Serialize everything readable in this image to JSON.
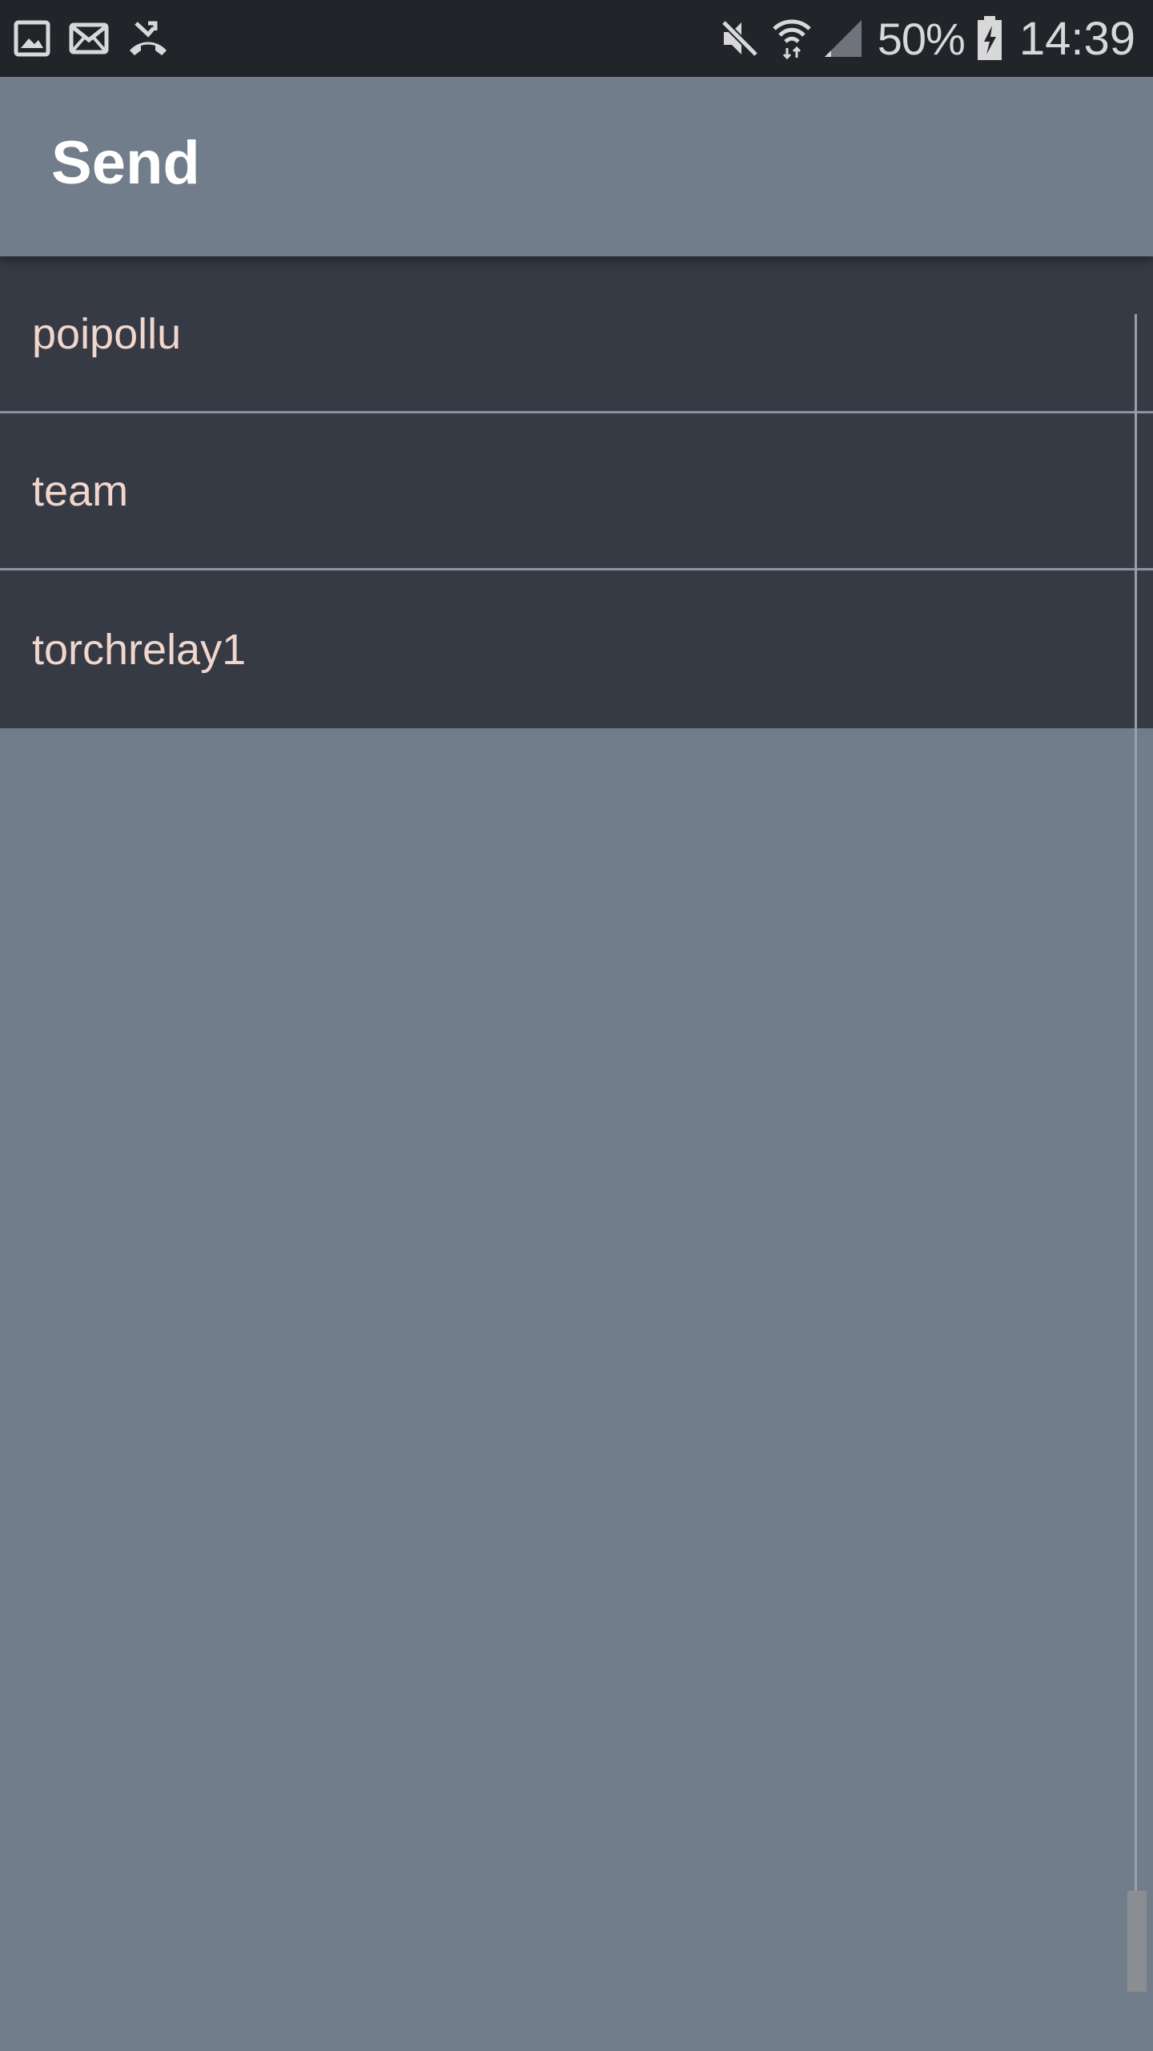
{
  "status_bar": {
    "notification_icons": [
      "image-icon",
      "mail-icon",
      "missed-call-icon"
    ],
    "system_icons": [
      "mute-icon",
      "wifi-icon",
      "signal-icon",
      "battery-charging-icon"
    ],
    "battery_percent": "50%",
    "time": "14:39"
  },
  "app_bar": {
    "title": "Send"
  },
  "list": {
    "items": [
      {
        "label": "poipollu"
      },
      {
        "label": "team"
      },
      {
        "label": "torchrelay1"
      }
    ]
  },
  "colors": {
    "status_bar_bg": "#212429",
    "app_bar_bg": "#717d8b",
    "list_item_bg": "#363a44",
    "list_divider": "#8c93a5",
    "item_text": "#f0d6cc",
    "page_bg": "#717d8b"
  }
}
